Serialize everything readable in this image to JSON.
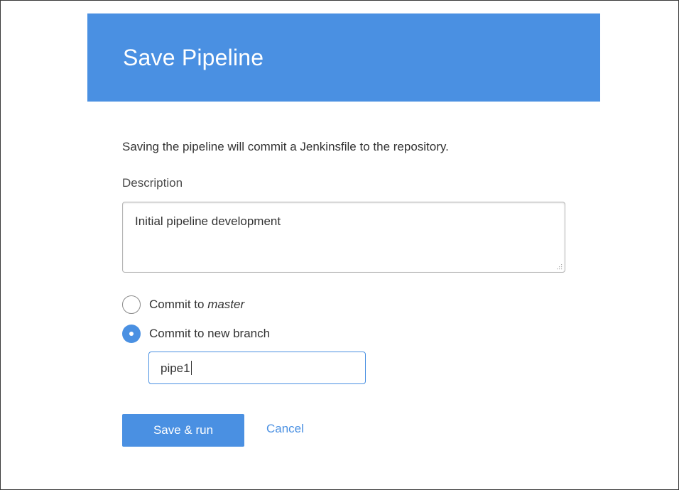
{
  "dialog": {
    "title": "Save Pipeline",
    "intro": "Saving the pipeline will commit a Jenkinsfile to the repository.",
    "description_label": "Description",
    "description_value": "Initial pipeline development",
    "radio_options": [
      {
        "prefix": "Commit to ",
        "emphasis": "master",
        "checked": false
      },
      {
        "prefix": "Commit to new branch",
        "emphasis": "",
        "checked": true
      }
    ],
    "branch_value": "pipe1",
    "save_run_label": "Save & run",
    "cancel_label": "Cancel"
  },
  "colors": {
    "accent": "#4a90e2",
    "text": "#333333",
    "border": "#b5b5b5"
  }
}
